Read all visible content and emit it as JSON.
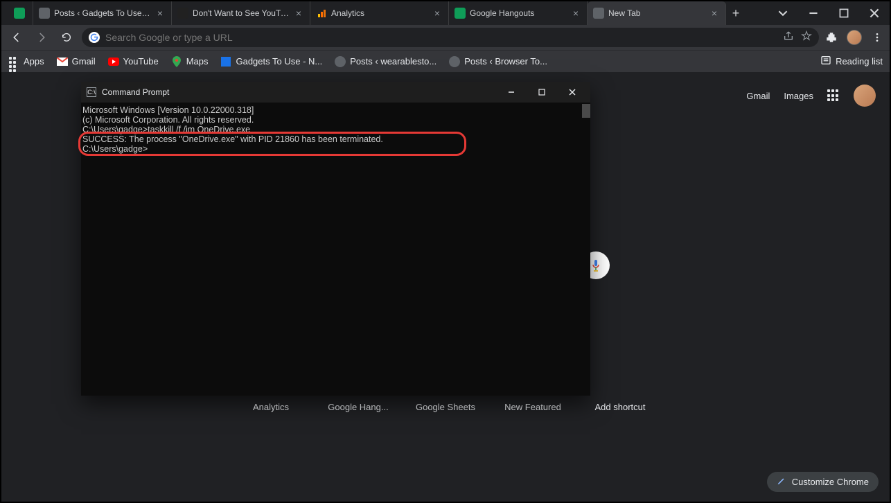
{
  "tabs": [
    {
      "title": "",
      "favicon": "sheets"
    },
    {
      "title": "Posts ‹ Gadgets To Use — WordP",
      "favicon": "globe"
    },
    {
      "title": "Don't Want to See YouTube Ads",
      "favicon": "yt-studio"
    },
    {
      "title": "Analytics",
      "favicon": "analytics"
    },
    {
      "title": "Google Hangouts",
      "favicon": "hangouts"
    },
    {
      "title": "New Tab",
      "favicon": "chrome",
      "active": true
    }
  ],
  "urlbar": {
    "placeholder": "Search Google or type a URL"
  },
  "bookmarks": [
    {
      "label": "Apps",
      "icon": "apps"
    },
    {
      "label": "Gmail",
      "icon": "gmail"
    },
    {
      "label": "YouTube",
      "icon": "youtube"
    },
    {
      "label": "Maps",
      "icon": "maps"
    },
    {
      "label": "Gadgets To Use - N...",
      "icon": "gtu"
    },
    {
      "label": "Posts ‹ wearablesto...",
      "icon": "globe"
    },
    {
      "label": "Posts ‹ Browser To...",
      "icon": "globe"
    }
  ],
  "reading_list_label": "Reading list",
  "page_links": {
    "gmail": "Gmail",
    "images": "Images"
  },
  "shortcuts": [
    "Analytics",
    "Google Hang...",
    "Google Sheets",
    "New Featured",
    "Add shortcut"
  ],
  "customize_label": "Customize Chrome",
  "cmd": {
    "title": "Command Prompt",
    "lines": [
      "Microsoft Windows [Version 10.0.22000.318]",
      "(c) Microsoft Corporation. All rights reserved.",
      "",
      "C:\\Users\\gadge>taskkill /f /im OneDrive.exe",
      "SUCCESS: The process \"OneDrive.exe\" with PID 21860 has been terminated.",
      "",
      "C:\\Users\\gadge>"
    ]
  }
}
